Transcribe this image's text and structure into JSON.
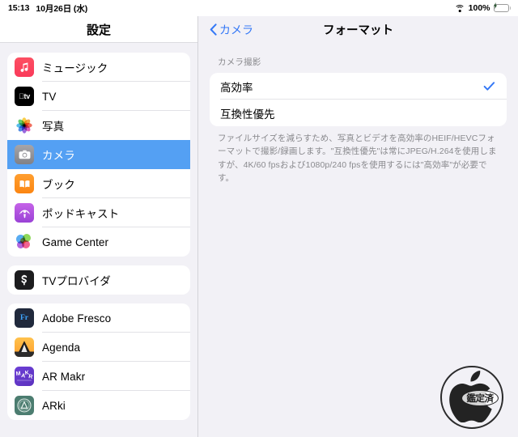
{
  "statusbar": {
    "time": "15:13",
    "date": "10月26日 (水)",
    "wifi_icon": "wifi-icon",
    "battery_percent": "100%",
    "battery_icon": "battery-charging-icon"
  },
  "sidebar": {
    "title": "設定",
    "groups": [
      {
        "name": "apple-apps",
        "items": [
          {
            "label": "ミュージック",
            "icon": "music-app-icon",
            "selected": false
          },
          {
            "label": "TV",
            "icon": "tv-app-icon",
            "selected": false
          },
          {
            "label": "写真",
            "icon": "photos-app-icon",
            "selected": false
          },
          {
            "label": "カメラ",
            "icon": "camera-app-icon",
            "selected": true
          },
          {
            "label": "ブック",
            "icon": "books-app-icon",
            "selected": false
          },
          {
            "label": "ポッドキャスト",
            "icon": "podcasts-app-icon",
            "selected": false
          },
          {
            "label": "Game Center",
            "icon": "game-center-icon",
            "selected": false
          }
        ]
      },
      {
        "name": "tv-provider",
        "items": [
          {
            "label": "TVプロバイダ",
            "icon": "tv-provider-icon",
            "selected": false
          }
        ]
      },
      {
        "name": "third-party-apps",
        "items": [
          {
            "label": "Adobe Fresco",
            "icon": "adobe-fresco-icon",
            "selected": false
          },
          {
            "label": "Agenda",
            "icon": "agenda-app-icon",
            "selected": false
          },
          {
            "label": "AR Makr",
            "icon": "ar-makr-icon",
            "selected": false
          },
          {
            "label": "ARki",
            "icon": "arki-app-icon",
            "selected": false
          }
        ]
      }
    ]
  },
  "detail": {
    "back_label": "カメラ",
    "back_icon": "chevron-left-icon",
    "title": "フォーマット",
    "section_header": "カメラ撮影",
    "options": [
      {
        "label": "高効率",
        "checked": true
      },
      {
        "label": "互換性優先",
        "checked": false
      }
    ],
    "check_icon": "checkmark-icon",
    "footer": "ファイルサイズを減らすため、写真とビデオを高効率のHEIF/HEVCフォーマットで撮影/録画します。\"互換性優先\"は常にJPEG/H.264を使用しますが、4K/60 fpsおよび1080p/240 fpsを使用するには\"高効率\"が必要です。"
  },
  "watermark": {
    "icon": "apple-logo-watermark",
    "stamp_text": "鑑定済"
  },
  "colors": {
    "selection_blue": "#54a0f3",
    "accent_blue": "#3478f6",
    "check_blue": "#3478f6",
    "battery_green": "#32d74b",
    "page_background": "#f2f1f6",
    "card_white": "#ffffff",
    "secondary_text": "#8a8a8e"
  }
}
